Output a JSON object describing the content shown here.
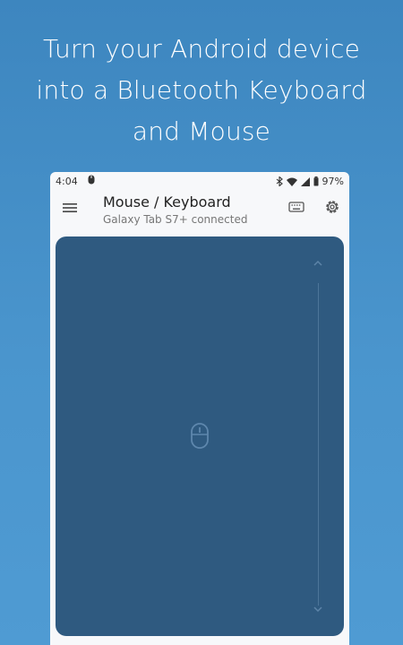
{
  "headline": {
    "line1": "Turn your Android device",
    "line2": "into a Bluetooth Keyboard",
    "line3": "and Mouse"
  },
  "statusbar": {
    "time": "4:04",
    "battery": "97%",
    "icons": [
      "bluetooth-icon",
      "wifi-icon",
      "signal-icon",
      "battery-icon"
    ]
  },
  "appbar": {
    "title": "Mouse / Keyboard",
    "subtitle": "Galaxy Tab S7+ connected",
    "icons": [
      "menu-icon",
      "keyboard-icon",
      "gear-icon"
    ]
  },
  "touchpad": {
    "center_icon": "mouse-icon",
    "scroll_icons": [
      "chevron-up-icon",
      "chevron-down-icon"
    ]
  },
  "colors": {
    "background": "#4a95cd",
    "touchpad": "#2f5a80",
    "phone_surface": "#f7f8fa"
  }
}
